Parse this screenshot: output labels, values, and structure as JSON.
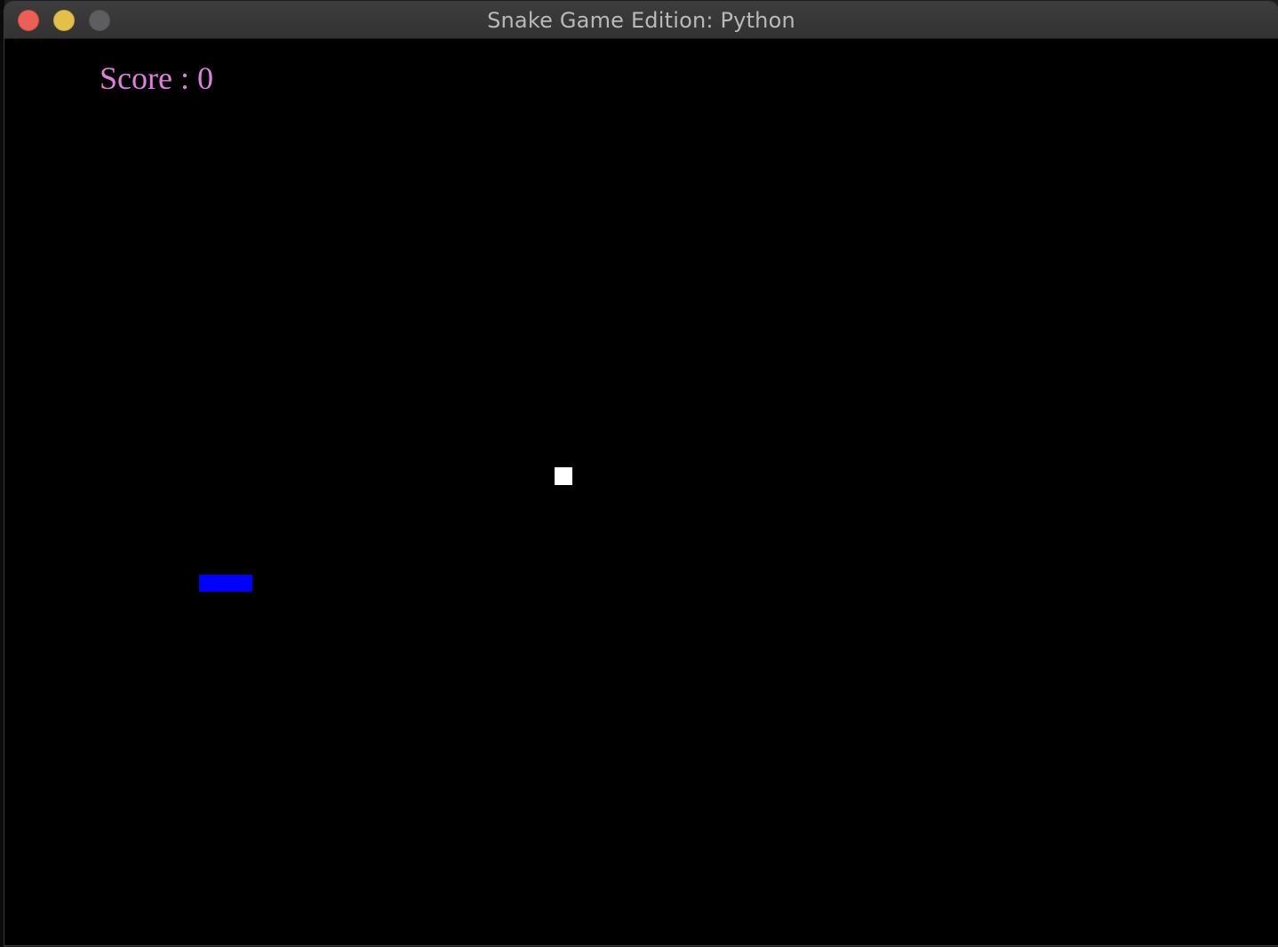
{
  "window": {
    "title": "Snake Game Edition: Python"
  },
  "game": {
    "score_label": "Score : 0",
    "score": 0,
    "colors": {
      "background": "#000000",
      "score_text": "#e07fe0",
      "snake": "#0000ff",
      "food": "#ffffff"
    },
    "snake": {
      "length": 3
    }
  }
}
